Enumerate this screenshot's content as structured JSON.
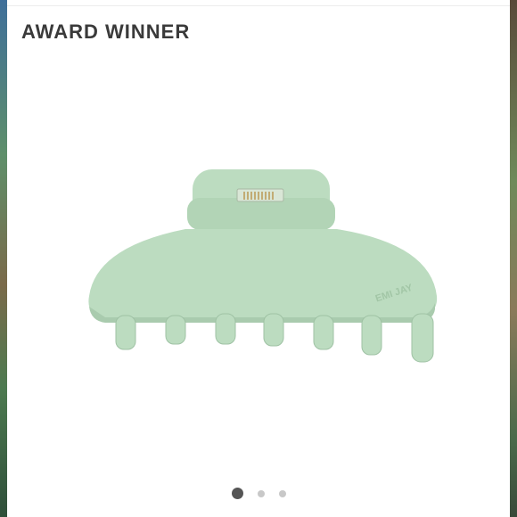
{
  "badge": {
    "label": "AWARD WINNER"
  },
  "product": {
    "image_icon": "hair-claw-clip",
    "brand_mark": "EMI JAY",
    "color": "#bcdcc0"
  },
  "carousel": {
    "count": 3,
    "active_index": 0
  }
}
